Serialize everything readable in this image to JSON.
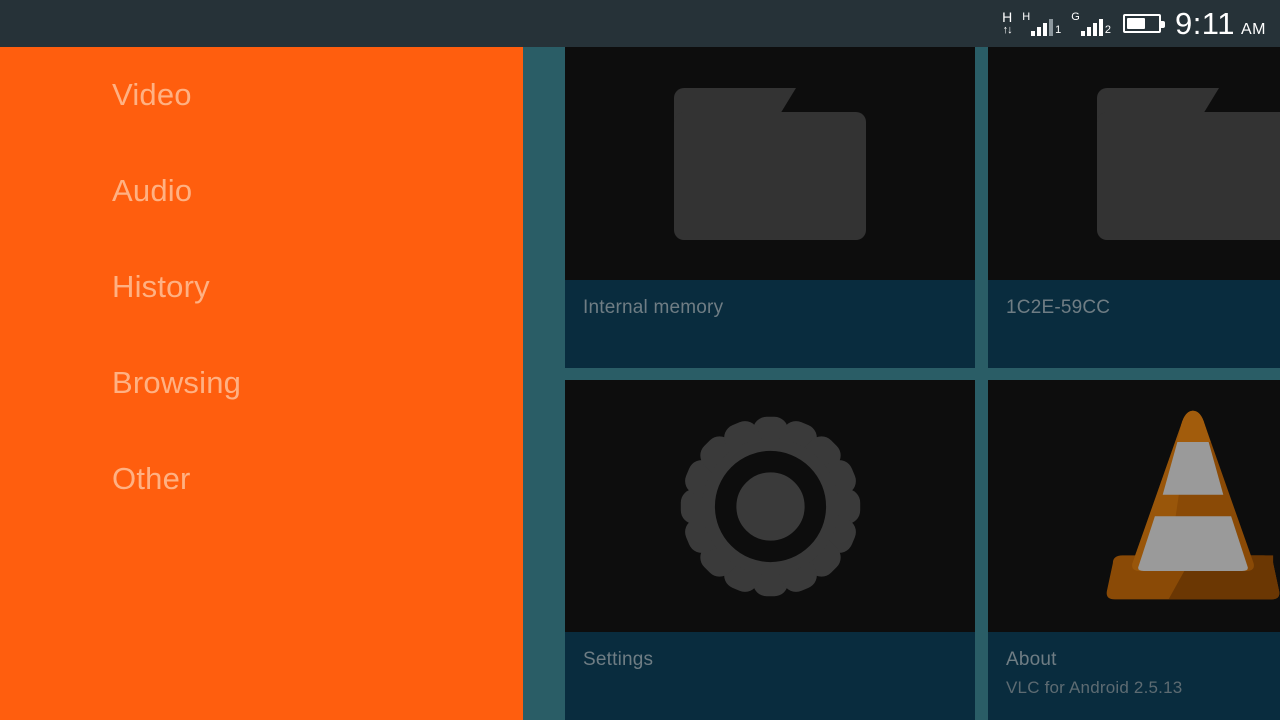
{
  "status_bar": {
    "network_type": "H",
    "data_arrows": "↑↓",
    "sim1_network": "H",
    "sim1_label": "1",
    "sim2_network": "G",
    "sim2_label": "2",
    "battery_level_percent": 60,
    "time": "9:11",
    "meridiem": "AM",
    "background_color": "#263238"
  },
  "drawer": {
    "background_color": "#ff5e0e",
    "text_color": "#ffb183",
    "items": [
      {
        "label": "Video",
        "icon": "video-icon",
        "selected": false
      },
      {
        "label": "Audio",
        "icon": "audio-icon",
        "selected": false
      },
      {
        "label": "History",
        "icon": "history-icon",
        "selected": false
      },
      {
        "label": "Browsing",
        "icon": "browse-icon",
        "selected": false
      },
      {
        "label": "Other",
        "icon": "other-icon",
        "selected": false
      }
    ]
  },
  "grid": {
    "background_color": "#2a5d66",
    "card_background": "#0d0d0d",
    "card_meta_background": "#092c3e",
    "cards": [
      {
        "title": "Internal memory",
        "subtitle": "",
        "icon": "folder-icon"
      },
      {
        "title": "1C2E-59CC",
        "subtitle": "",
        "icon": "folder-icon"
      },
      {
        "title": "Settings",
        "subtitle": "",
        "icon": "gear-icon"
      },
      {
        "title": "About",
        "subtitle": "VLC for Android 2.5.13",
        "icon": "vlc-cone-icon"
      }
    ]
  },
  "app": {
    "name": "VLC for Android",
    "version": "2.5.13"
  }
}
